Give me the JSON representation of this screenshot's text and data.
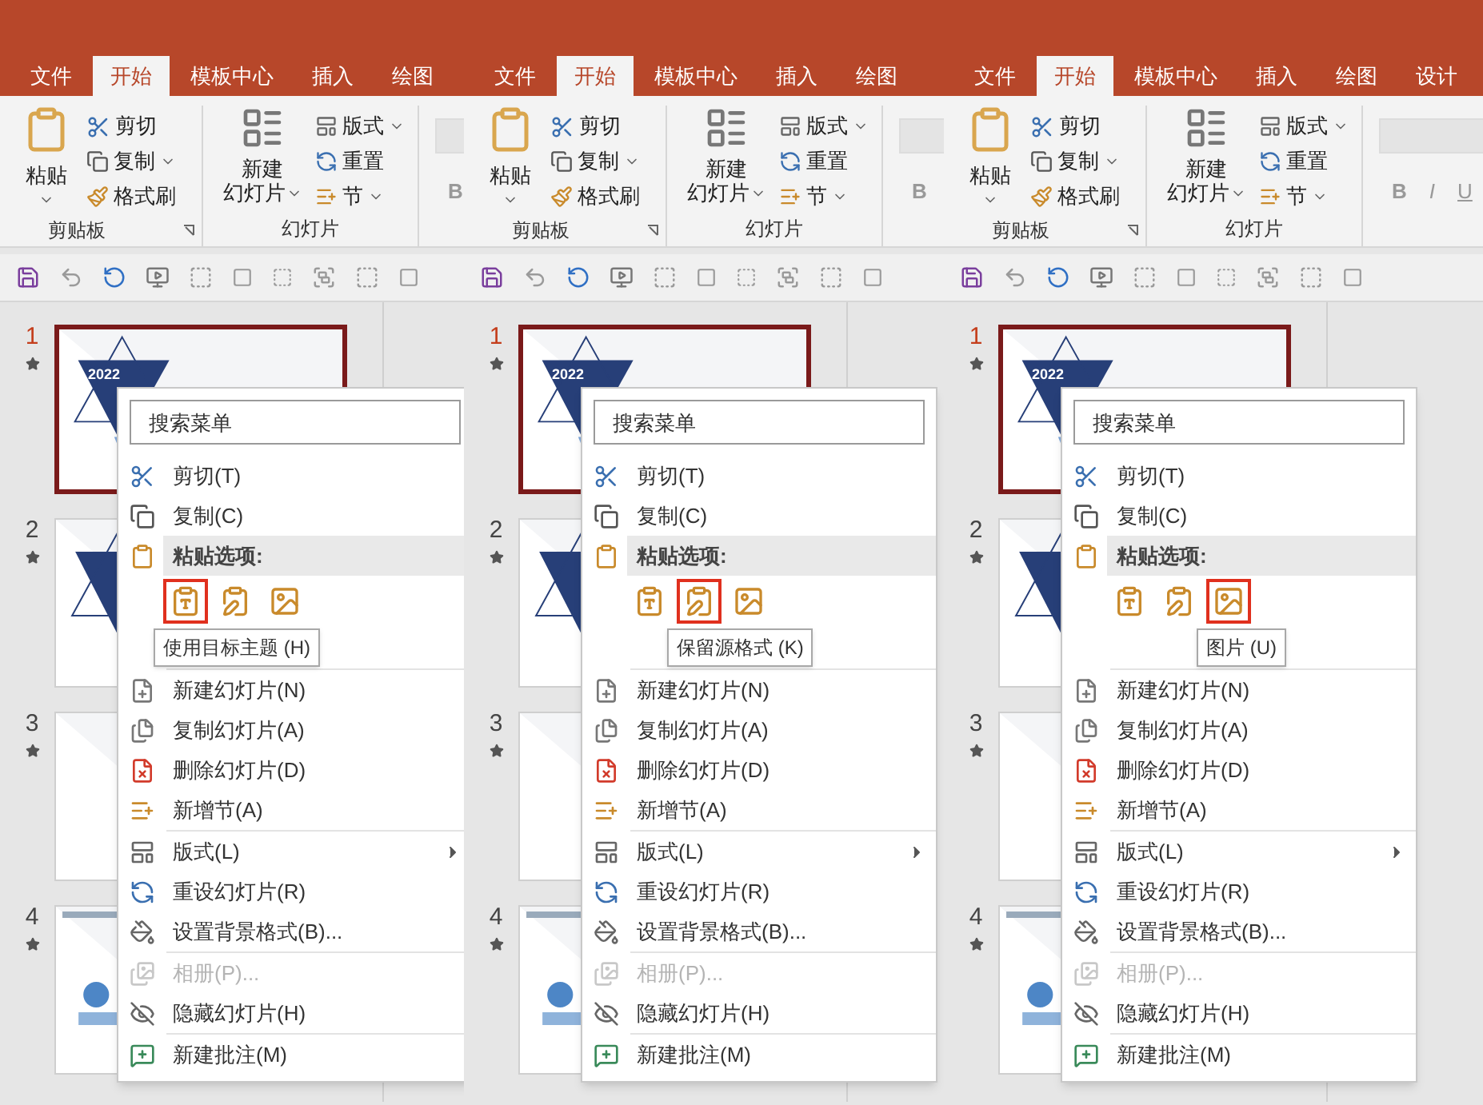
{
  "panels": [
    {
      "tabs": [
        {
          "label": "文件",
          "selected": false
        },
        {
          "label": "开始",
          "selected": true
        },
        {
          "label": "模板中心",
          "selected": false
        },
        {
          "label": "插入",
          "selected": false
        },
        {
          "label": "绘图",
          "selected": false
        }
      ],
      "ribbon": {
        "clipboard": {
          "label": "剪贴板",
          "paste": "粘贴",
          "cut": "剪切",
          "copy": "复制",
          "painter": "格式刷"
        },
        "slides": {
          "label": "幻灯片",
          "new_slide": [
            "新建",
            "幻灯片"
          ],
          "layout": "版式",
          "reset": "重置",
          "section": "节"
        },
        "font": {
          "buttons": [
            "B"
          ]
        }
      },
      "slides": [
        {
          "number": "1",
          "selected": true,
          "title": "2022"
        },
        {
          "number": "2",
          "selected": false
        },
        {
          "number": "3",
          "selected": false
        },
        {
          "number": "4",
          "selected": false
        }
      ],
      "menu": {
        "search": {
          "placeholder": "搜索菜单"
        },
        "sections": [
          [
            {
              "kind": "item",
              "label": "剪切(T)",
              "disabled": false,
              "submenu": false
            },
            {
              "kind": "item",
              "label": "复制(C)",
              "disabled": false,
              "submenu": false
            },
            {
              "kind": "header",
              "label": "粘贴选项:"
            },
            {
              "kind": "paste_options",
              "options": [
                {
                  "selected": true
                },
                {
                  "selected": false
                },
                {
                  "selected": false
                }
              ]
            }
          ],
          [
            {
              "kind": "item",
              "label": "新建幻灯片(N)",
              "disabled": false,
              "submenu": false
            },
            {
              "kind": "item",
              "label": "复制幻灯片(A)",
              "disabled": false,
              "submenu": false
            },
            {
              "kind": "item",
              "label": "删除幻灯片(D)",
              "disabled": false,
              "submenu": false
            },
            {
              "kind": "item",
              "label": "新增节(A)",
              "disabled": false,
              "submenu": false
            }
          ],
          [
            {
              "kind": "item",
              "label": "版式(L)",
              "disabled": false,
              "submenu": true
            },
            {
              "kind": "item",
              "label": "重设幻灯片(R)",
              "disabled": false,
              "submenu": false
            },
            {
              "kind": "item",
              "label": "设置背景格式(B)...",
              "disabled": false,
              "submenu": false
            }
          ],
          [
            {
              "kind": "item",
              "label": "相册(P)...",
              "disabled": true,
              "submenu": false
            },
            {
              "kind": "item",
              "label": "隐藏幻灯片(H)",
              "disabled": false,
              "submenu": false
            }
          ],
          [
            {
              "kind": "item",
              "label": "新建批注(M)",
              "disabled": false,
              "submenu": false
            }
          ]
        ]
      },
      "tooltip": "使用目标主题 (H)"
    },
    {
      "tabs": [
        {
          "label": "文件",
          "selected": false
        },
        {
          "label": "开始",
          "selected": true
        },
        {
          "label": "模板中心",
          "selected": false
        },
        {
          "label": "插入",
          "selected": false
        },
        {
          "label": "绘图",
          "selected": false
        }
      ],
      "ribbon": {
        "clipboard": {
          "label": "剪贴板",
          "paste": "粘贴",
          "cut": "剪切",
          "copy": "复制",
          "painter": "格式刷"
        },
        "slides": {
          "label": "幻灯片",
          "new_slide": [
            "新建",
            "幻灯片"
          ],
          "layout": "版式",
          "reset": "重置",
          "section": "节"
        },
        "font": {
          "buttons": [
            "B"
          ]
        }
      },
      "slides": [
        {
          "number": "1",
          "selected": true,
          "title": "2022"
        },
        {
          "number": "2",
          "selected": false
        },
        {
          "number": "3",
          "selected": false
        },
        {
          "number": "4",
          "selected": false
        }
      ],
      "menu": {
        "search": {
          "placeholder": "搜索菜单"
        },
        "sections": [
          [
            {
              "kind": "item",
              "label": "剪切(T)",
              "disabled": false,
              "submenu": false
            },
            {
              "kind": "item",
              "label": "复制(C)",
              "disabled": false,
              "submenu": false
            },
            {
              "kind": "header",
              "label": "粘贴选项:"
            },
            {
              "kind": "paste_options",
              "options": [
                {
                  "selected": false
                },
                {
                  "selected": true
                },
                {
                  "selected": false
                }
              ]
            }
          ],
          [
            {
              "kind": "item",
              "label": "新建幻灯片(N)",
              "disabled": false,
              "submenu": false
            },
            {
              "kind": "item",
              "label": "复制幻灯片(A)",
              "disabled": false,
              "submenu": false
            },
            {
              "kind": "item",
              "label": "删除幻灯片(D)",
              "disabled": false,
              "submenu": false
            },
            {
              "kind": "item",
              "label": "新增节(A)",
              "disabled": false,
              "submenu": false
            }
          ],
          [
            {
              "kind": "item",
              "label": "版式(L)",
              "disabled": false,
              "submenu": true
            },
            {
              "kind": "item",
              "label": "重设幻灯片(R)",
              "disabled": false,
              "submenu": false
            },
            {
              "kind": "item",
              "label": "设置背景格式(B)...",
              "disabled": false,
              "submenu": false
            }
          ],
          [
            {
              "kind": "item",
              "label": "相册(P)...",
              "disabled": true,
              "submenu": false
            },
            {
              "kind": "item",
              "label": "隐藏幻灯片(H)",
              "disabled": false,
              "submenu": false
            }
          ],
          [
            {
              "kind": "item",
              "label": "新建批注(M)",
              "disabled": false,
              "submenu": false
            }
          ]
        ]
      },
      "tooltip": "保留源格式 (K)"
    },
    {
      "tabs": [
        {
          "label": "文件",
          "selected": false
        },
        {
          "label": "开始",
          "selected": true
        },
        {
          "label": "模板中心",
          "selected": false
        },
        {
          "label": "插入",
          "selected": false
        },
        {
          "label": "绘图",
          "selected": false
        },
        {
          "label": "设计",
          "selected": false
        }
      ],
      "ribbon": {
        "clipboard": {
          "label": "剪贴板",
          "paste": "粘贴",
          "cut": "剪切",
          "copy": "复制",
          "painter": "格式刷"
        },
        "slides": {
          "label": "幻灯片",
          "new_slide": [
            "新建",
            "幻灯片"
          ],
          "layout": "版式",
          "reset": "重置",
          "section": "节"
        },
        "font": {
          "buttons": [
            "B",
            "I",
            "U"
          ]
        }
      },
      "slides": [
        {
          "number": "1",
          "selected": true,
          "title": "2022"
        },
        {
          "number": "2",
          "selected": false
        },
        {
          "number": "3",
          "selected": false
        },
        {
          "number": "4",
          "selected": false
        }
      ],
      "menu": {
        "search": {
          "placeholder": "搜索菜单"
        },
        "sections": [
          [
            {
              "kind": "item",
              "label": "剪切(T)",
              "disabled": false,
              "submenu": false
            },
            {
              "kind": "item",
              "label": "复制(C)",
              "disabled": false,
              "submenu": false
            },
            {
              "kind": "header",
              "label": "粘贴选项:"
            },
            {
              "kind": "paste_options",
              "options": [
                {
                  "selected": false
                },
                {
                  "selected": false
                },
                {
                  "selected": true
                }
              ]
            }
          ],
          [
            {
              "kind": "item",
              "label": "新建幻灯片(N)",
              "disabled": false,
              "submenu": false
            },
            {
              "kind": "item",
              "label": "复制幻灯片(A)",
              "disabled": false,
              "submenu": false
            },
            {
              "kind": "item",
              "label": "删除幻灯片(D)",
              "disabled": false,
              "submenu": false
            },
            {
              "kind": "item",
              "label": "新增节(A)",
              "disabled": false,
              "submenu": false
            }
          ],
          [
            {
              "kind": "item",
              "label": "版式(L)",
              "disabled": false,
              "submenu": true
            },
            {
              "kind": "item",
              "label": "重设幻灯片(R)",
              "disabled": false,
              "submenu": false
            },
            {
              "kind": "item",
              "label": "设置背景格式(B)...",
              "disabled": false,
              "submenu": false
            }
          ],
          [
            {
              "kind": "item",
              "label": "相册(P)...",
              "disabled": true,
              "submenu": false
            },
            {
              "kind": "item",
              "label": "隐藏幻灯片(H)",
              "disabled": false,
              "submenu": false
            }
          ],
          [
            {
              "kind": "item",
              "label": "新建批注(M)",
              "disabled": false,
              "submenu": false
            }
          ]
        ]
      },
      "tooltip": "图片 (U)"
    }
  ]
}
